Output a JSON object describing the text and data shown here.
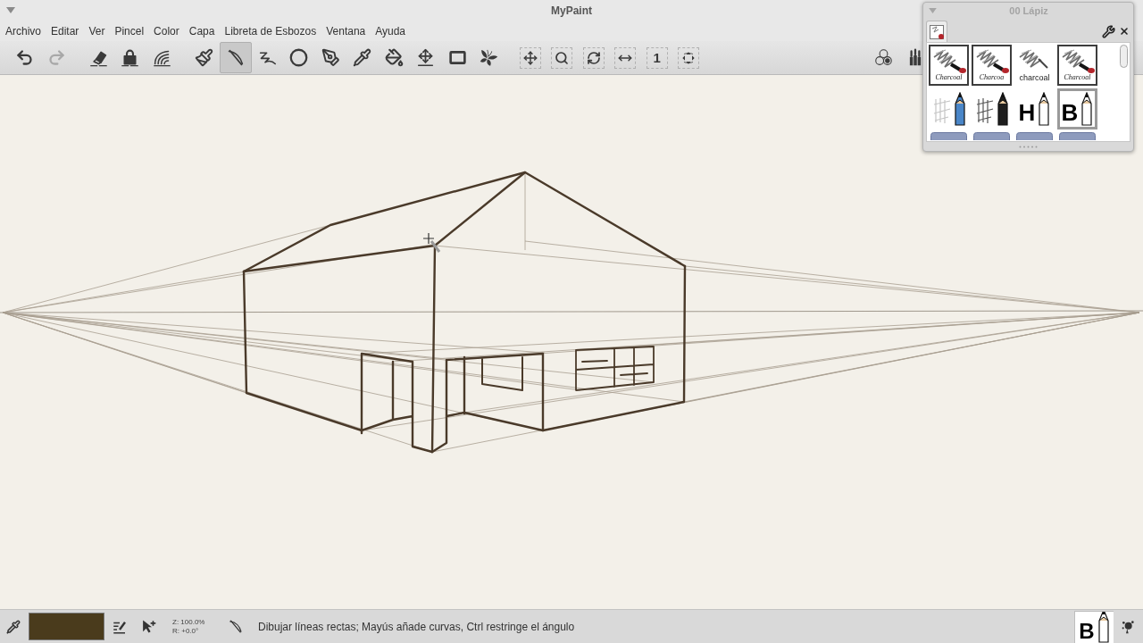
{
  "window": {
    "title": "MyPaint"
  },
  "menu": [
    "Archivo",
    "Editar",
    "Ver",
    "Pincel",
    "Color",
    "Capa",
    "Libreta de Esbozos",
    "Ventana",
    "Ayuda"
  ],
  "toolbar": {
    "groups": [
      {
        "tools": [
          {
            "kind": "undo",
            "selected": false,
            "disabled": false
          },
          {
            "kind": "redo",
            "selected": false,
            "disabled": true
          }
        ]
      },
      {
        "tools": [
          {
            "kind": "eraser",
            "selected": false,
            "disabled": false
          },
          {
            "kind": "lock",
            "selected": false,
            "disabled": false
          },
          {
            "kind": "rainbow",
            "selected": false,
            "disabled": false
          }
        ]
      },
      {
        "tools": [
          {
            "kind": "brush",
            "selected": false,
            "disabled": false
          },
          {
            "kind": "line",
            "selected": true,
            "disabled": false
          },
          {
            "kind": "squiggle",
            "selected": false,
            "disabled": false
          },
          {
            "kind": "ellipse",
            "selected": false,
            "disabled": false
          },
          {
            "kind": "inking",
            "selected": false,
            "disabled": false
          },
          {
            "kind": "picker",
            "selected": false,
            "disabled": false
          },
          {
            "kind": "fill",
            "selected": false,
            "disabled": false
          },
          {
            "kind": "move",
            "selected": false,
            "disabled": false
          },
          {
            "kind": "frame",
            "selected": false,
            "disabled": false
          },
          {
            "kind": "symmetry",
            "selected": false,
            "disabled": false
          }
        ]
      },
      {
        "tools": [
          {
            "kind": "pan",
            "selected": false,
            "disabled": false
          },
          {
            "kind": "zoom",
            "selected": false,
            "disabled": false
          },
          {
            "kind": "rotate",
            "selected": false,
            "disabled": false
          },
          {
            "kind": "mirror",
            "selected": false,
            "disabled": false
          },
          {
            "kind": "reset",
            "label": "1",
            "selected": false,
            "disabled": false
          },
          {
            "kind": "fit",
            "selected": false,
            "disabled": false
          }
        ]
      },
      {
        "tools": [
          {
            "kind": "circles",
            "selected": false,
            "disabled": false
          },
          {
            "kind": "brushes",
            "selected": false,
            "disabled": false
          }
        ]
      }
    ]
  },
  "brush_panel": {
    "title": "00 Lápiz",
    "brushes": [
      {
        "kind": "charcoal",
        "label": "Charcoal",
        "selected": false
      },
      {
        "kind": "charcoal",
        "label": "Charcoa",
        "selected": false
      },
      {
        "kind": "charcoal-sketch",
        "label": "charcoal",
        "selected": false
      },
      {
        "kind": "charcoal",
        "label": "Charcoal",
        "selected": false
      },
      {
        "kind": "blue-pencil",
        "selected": false
      },
      {
        "kind": "graphite-pencil",
        "selected": false
      },
      {
        "kind": "letter-pencil",
        "label": "H",
        "selected": false
      },
      {
        "kind": "letter-pencil",
        "label": "B",
        "selected": true
      },
      {
        "kind": "pencil-tag",
        "selected": false
      },
      {
        "kind": "pencil-tag",
        "selected": false
      },
      {
        "kind": "pencil-tag",
        "selected": false
      },
      {
        "kind": "pencil-tag",
        "selected": false
      }
    ]
  },
  "status_bar": {
    "color": "#4a3b1c",
    "zoom": "Z: 100.0%",
    "rotation": "R: +0.0°",
    "message": "Dibujar líneas rectas; Mayús añade curvas, Ctrl restringe el ángulo",
    "current_brush": {
      "kind": "letter-pencil",
      "label": "B"
    }
  }
}
